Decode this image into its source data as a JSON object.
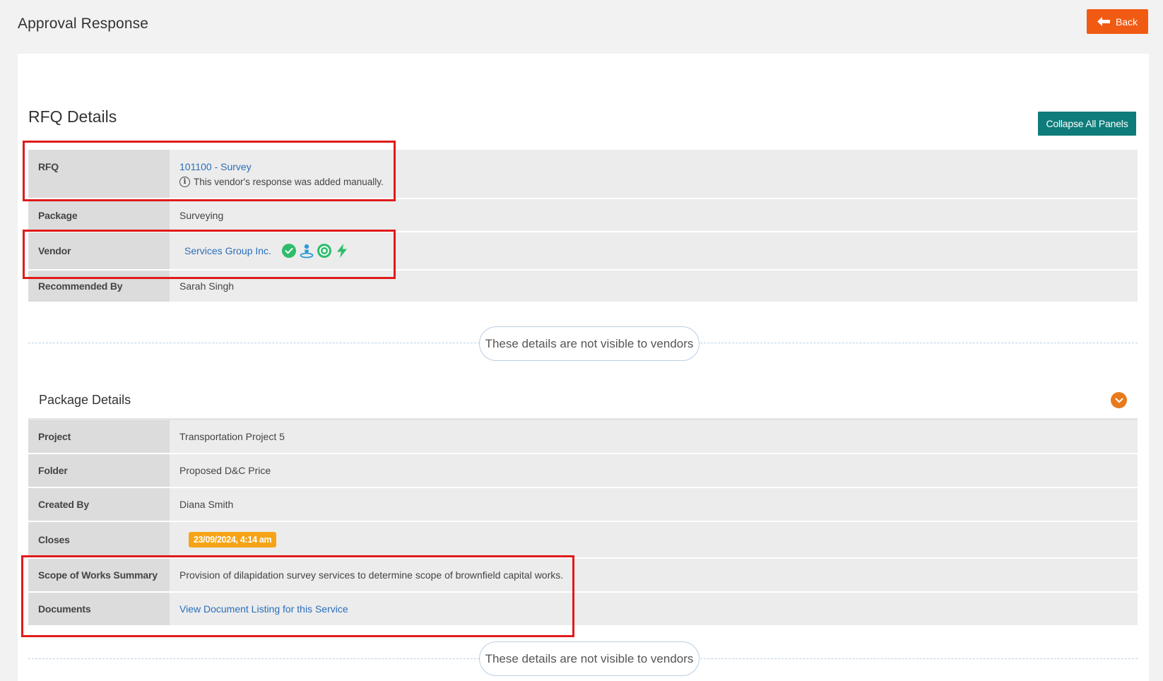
{
  "header": {
    "title": "Approval Response",
    "back_label": "Back"
  },
  "rfq_section": {
    "title": "RFQ Details",
    "collapse_label": "Collapse All Panels",
    "rows": {
      "rfq": {
        "label": "RFQ",
        "value": "101100 - Survey",
        "note": "This vendor's response was added manually."
      },
      "package": {
        "label": "Package",
        "value": "Surveying"
      },
      "vendor": {
        "label": "Vendor",
        "value": "Services Group Inc.",
        "badges": [
          "verified-check-icon",
          "person-pin-icon",
          "target-icon",
          "lightning-icon"
        ]
      },
      "recommended_by": {
        "label": "Recommended By",
        "value": "Sarah Singh"
      }
    }
  },
  "visibility_notice": "These details are not visible to vendors",
  "package_section": {
    "title": "Package Details",
    "rows": {
      "project": {
        "label": "Project",
        "value": "Transportation Project 5"
      },
      "folder": {
        "label": "Folder",
        "value": "Proposed D&C Price"
      },
      "created_by": {
        "label": "Created By",
        "value": "Diana Smith"
      },
      "closes": {
        "label": "Closes",
        "value": "23/09/2024, 4:14 am"
      },
      "scope": {
        "label": "Scope of Works Summary",
        "value": "Provision of dilapidation survey services to determine scope of brownfield capital works."
      },
      "documents": {
        "label": "Documents",
        "value": "View Document Listing for this Service"
      }
    }
  },
  "colors": {
    "back_button": "#f15a12",
    "collapse_button": "#0e7c7b",
    "date_badge": "#f6a417",
    "highlight_box": "#e01b1b",
    "link": "#2a6ebb"
  }
}
